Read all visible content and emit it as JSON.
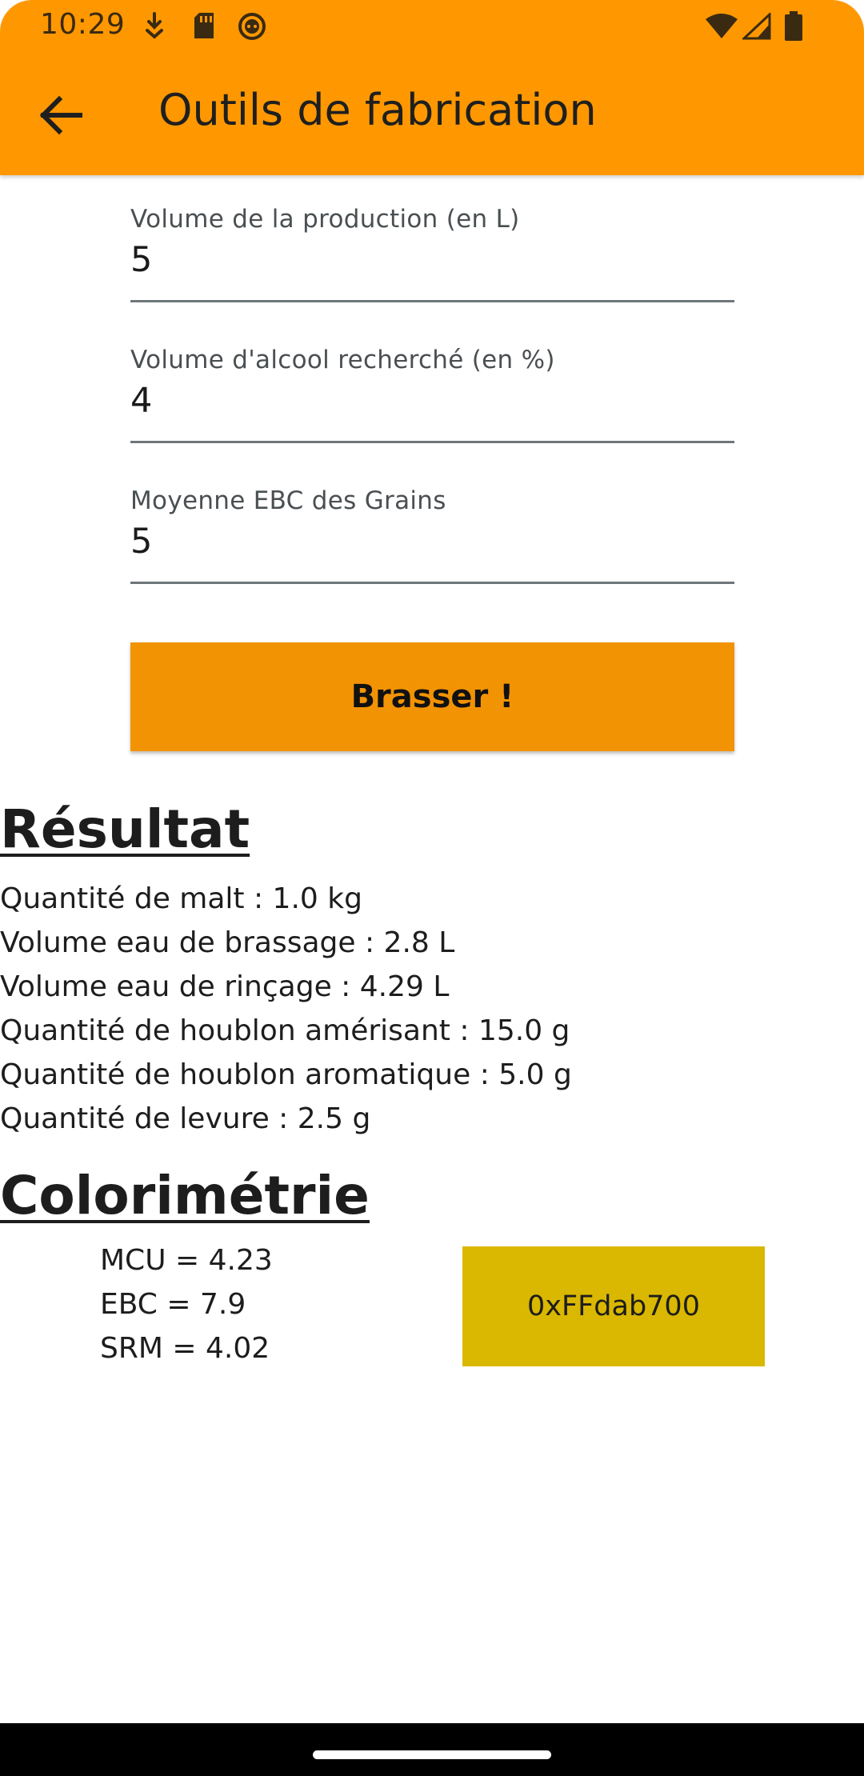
{
  "status_bar": {
    "time": "10:29",
    "left_icons": [
      "download-icon",
      "sd-card-icon",
      "android-face-icon"
    ],
    "right_icons": [
      "wifi-icon",
      "signal-icon",
      "battery-icon"
    ]
  },
  "app_bar": {
    "title": "Outils de fabrication",
    "back_icon": "arrow-back-icon",
    "color": "#ff9800"
  },
  "form": {
    "fields": [
      {
        "label": "Volume de la production (en L)",
        "value": "5"
      },
      {
        "label": "Volume d'alcool recherché (en %)",
        "value": "4"
      },
      {
        "label": "Moyenne EBC des Grains",
        "value": "5"
      }
    ],
    "submit_label": "Brasser !",
    "button_color": "#f29304"
  },
  "result": {
    "heading": "Résultat",
    "lines": [
      "Quantité de malt : 1.0 kg",
      "Volume eau de brassage : 2.8 L",
      "Volume eau de rinçage : 4.29 L",
      "Quantité de houblon amérisant : 15.0 g",
      "Quantité de houblon aromatique : 5.0 g",
      "Quantité de levure : 2.5 g"
    ]
  },
  "colorimetry": {
    "heading": "Colorimétrie",
    "values": [
      "MCU = 4.23",
      "EBC = 7.9",
      "SRM = 4.02"
    ],
    "swatch_label": "0xFFdab700",
    "swatch_color": "#dab700"
  }
}
